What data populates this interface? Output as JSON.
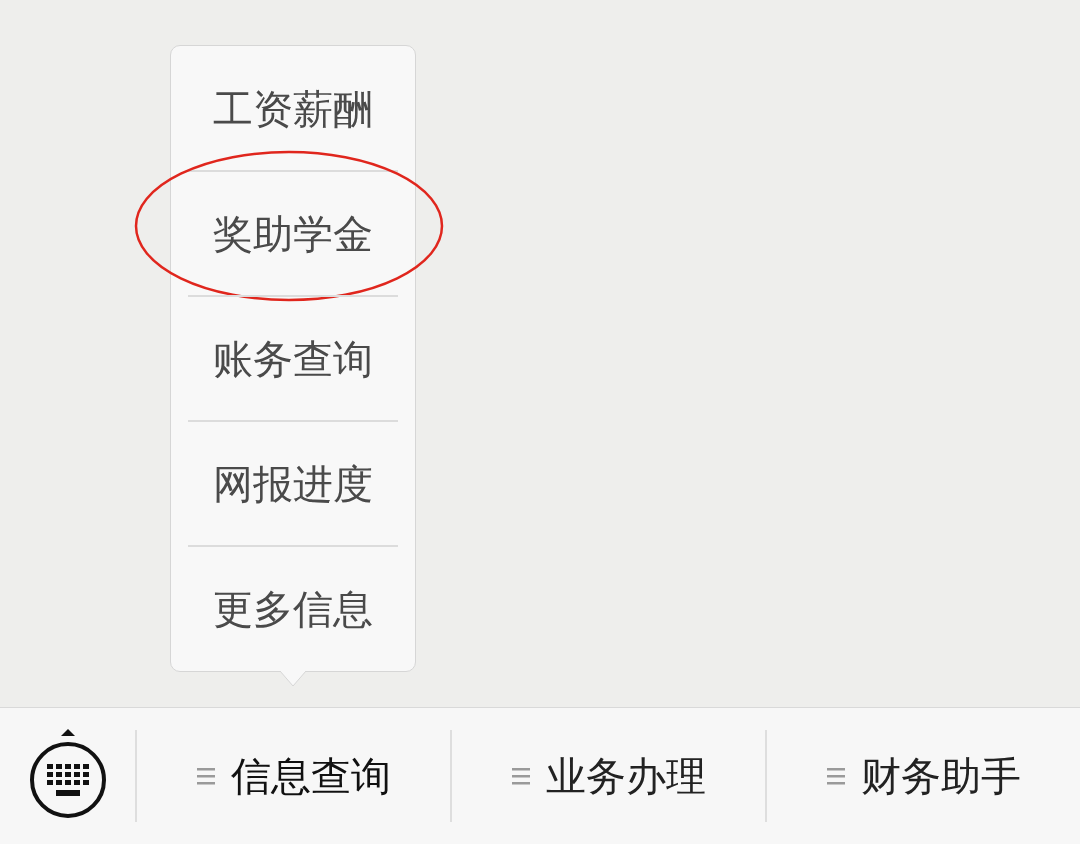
{
  "menu": {
    "items": [
      {
        "label": "工资薪酬",
        "circled": false
      },
      {
        "label": "奖助学金",
        "circled": true
      },
      {
        "label": "账务查询",
        "circled": false
      },
      {
        "label": "网报进度",
        "circled": false
      },
      {
        "label": "更多信息",
        "circled": false
      }
    ]
  },
  "bottom_bar": {
    "tabs": [
      {
        "label": "信息查询",
        "open": true
      },
      {
        "label": "业务办理",
        "open": false
      },
      {
        "label": "财务助手",
        "open": false
      }
    ]
  }
}
